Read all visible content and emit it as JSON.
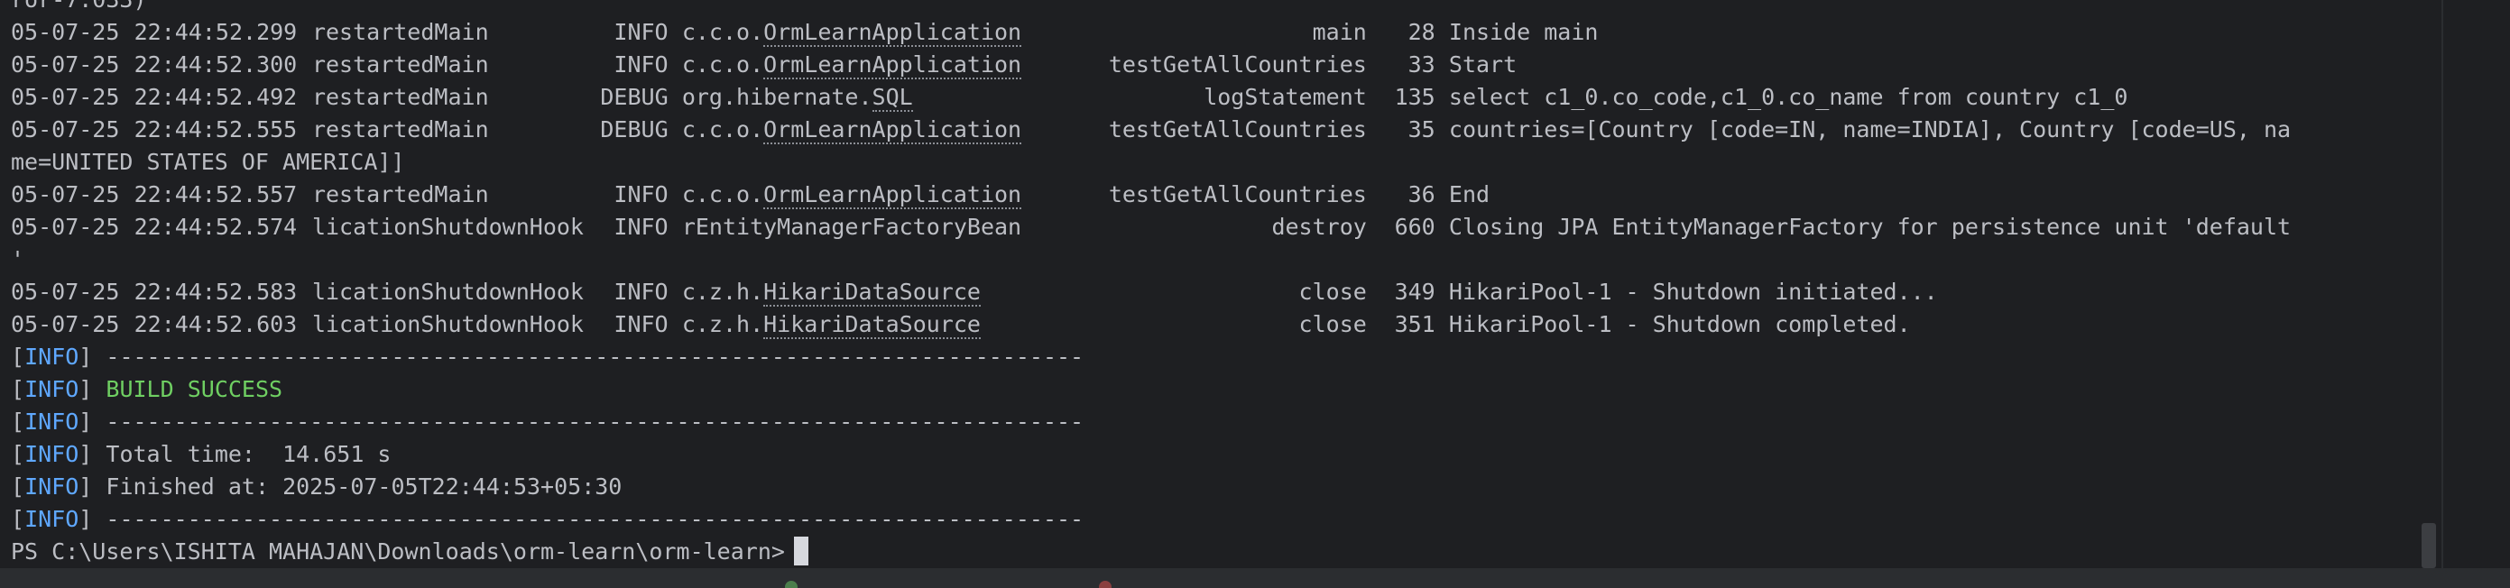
{
  "terminal": {
    "top_partial": "ror-7.033)",
    "log_lines": [
      {
        "date": "05-07-25",
        "time": "22:44:52.299",
        "thread": "restartedMain",
        "level": "INFO",
        "pkg": "c.c.o.",
        "logger": "OrmLearnApplication",
        "method": "main",
        "line_no": "28",
        "message": "Inside main"
      },
      {
        "date": "05-07-25",
        "time": "22:44:52.300",
        "thread": "restartedMain",
        "level": "INFO",
        "pkg": "c.c.o.",
        "logger": "OrmLearnApplication",
        "method": "testGetAllCountries",
        "line_no": "33",
        "message": "Start"
      },
      {
        "date": "05-07-25",
        "time": "22:44:52.492",
        "thread": "restartedMain",
        "level": "DEBUG",
        "pkg": "org.hibernate.",
        "logger": "SQL",
        "method": "logStatement",
        "line_no": "135",
        "message": "select c1_0.co_code,c1_0.co_name from country c1_0"
      },
      {
        "date": "05-07-25",
        "time": "22:44:52.555",
        "thread": "restartedMain",
        "level": "DEBUG",
        "pkg": "c.c.o.",
        "logger": "OrmLearnApplication",
        "method": "testGetAllCountries",
        "line_no": "35",
        "message": "countries=[Country [code=IN, name=INDIA], Country [code=US, na",
        "cont": "me=UNITED STATES OF AMERICA]]"
      },
      {
        "date": "05-07-25",
        "time": "22:44:52.557",
        "thread": "restartedMain",
        "level": "INFO",
        "pkg": "c.c.o.",
        "logger": "OrmLearnApplication",
        "method": "testGetAllCountries",
        "line_no": "36",
        "message": "End"
      },
      {
        "date": "05-07-25",
        "time": "22:44:52.574",
        "thread": "licationShutdownHook",
        "level": "INFO",
        "pkg": "rEntityManagerFactoryBean",
        "logger": "",
        "method": "destroy",
        "line_no": "660",
        "message": "Closing JPA EntityManagerFactory for persistence unit 'default",
        "cont": "'"
      },
      {
        "date": "05-07-25",
        "time": "22:44:52.583",
        "thread": "licationShutdownHook",
        "level": "INFO",
        "pkg": "c.z.h.",
        "logger": "HikariDataSource",
        "method": "close",
        "line_no": "349",
        "message": "HikariPool-1 - Shutdown initiated..."
      },
      {
        "date": "05-07-25",
        "time": "22:44:52.603",
        "thread": "licationShutdownHook",
        "level": "INFO",
        "pkg": "c.z.h.",
        "logger": "HikariDataSource",
        "method": "close",
        "line_no": "351",
        "message": "HikariPool-1 - Shutdown completed."
      }
    ],
    "maven": {
      "open_bracket": "[",
      "info": "INFO",
      "close_bracket": "]",
      "separator": "------------------------------------------------------------------------",
      "build_success": "BUILD SUCCESS",
      "total_time": "Total time:  14.651 s",
      "finished_at": "Finished at: 2025-07-05T22:44:53+05:30"
    },
    "prompt": "PS C:\\Users\\ISHITA MAHAJAN\\Downloads\\orm-learn\\orm-learn>"
  },
  "colors": {
    "background": "#1e1f22",
    "text": "#bcbec4",
    "info_accent": "#5fa8ff",
    "success": "#6fcf62"
  },
  "icons": [
    "cursor-block",
    "scrollbar-thumb"
  ]
}
